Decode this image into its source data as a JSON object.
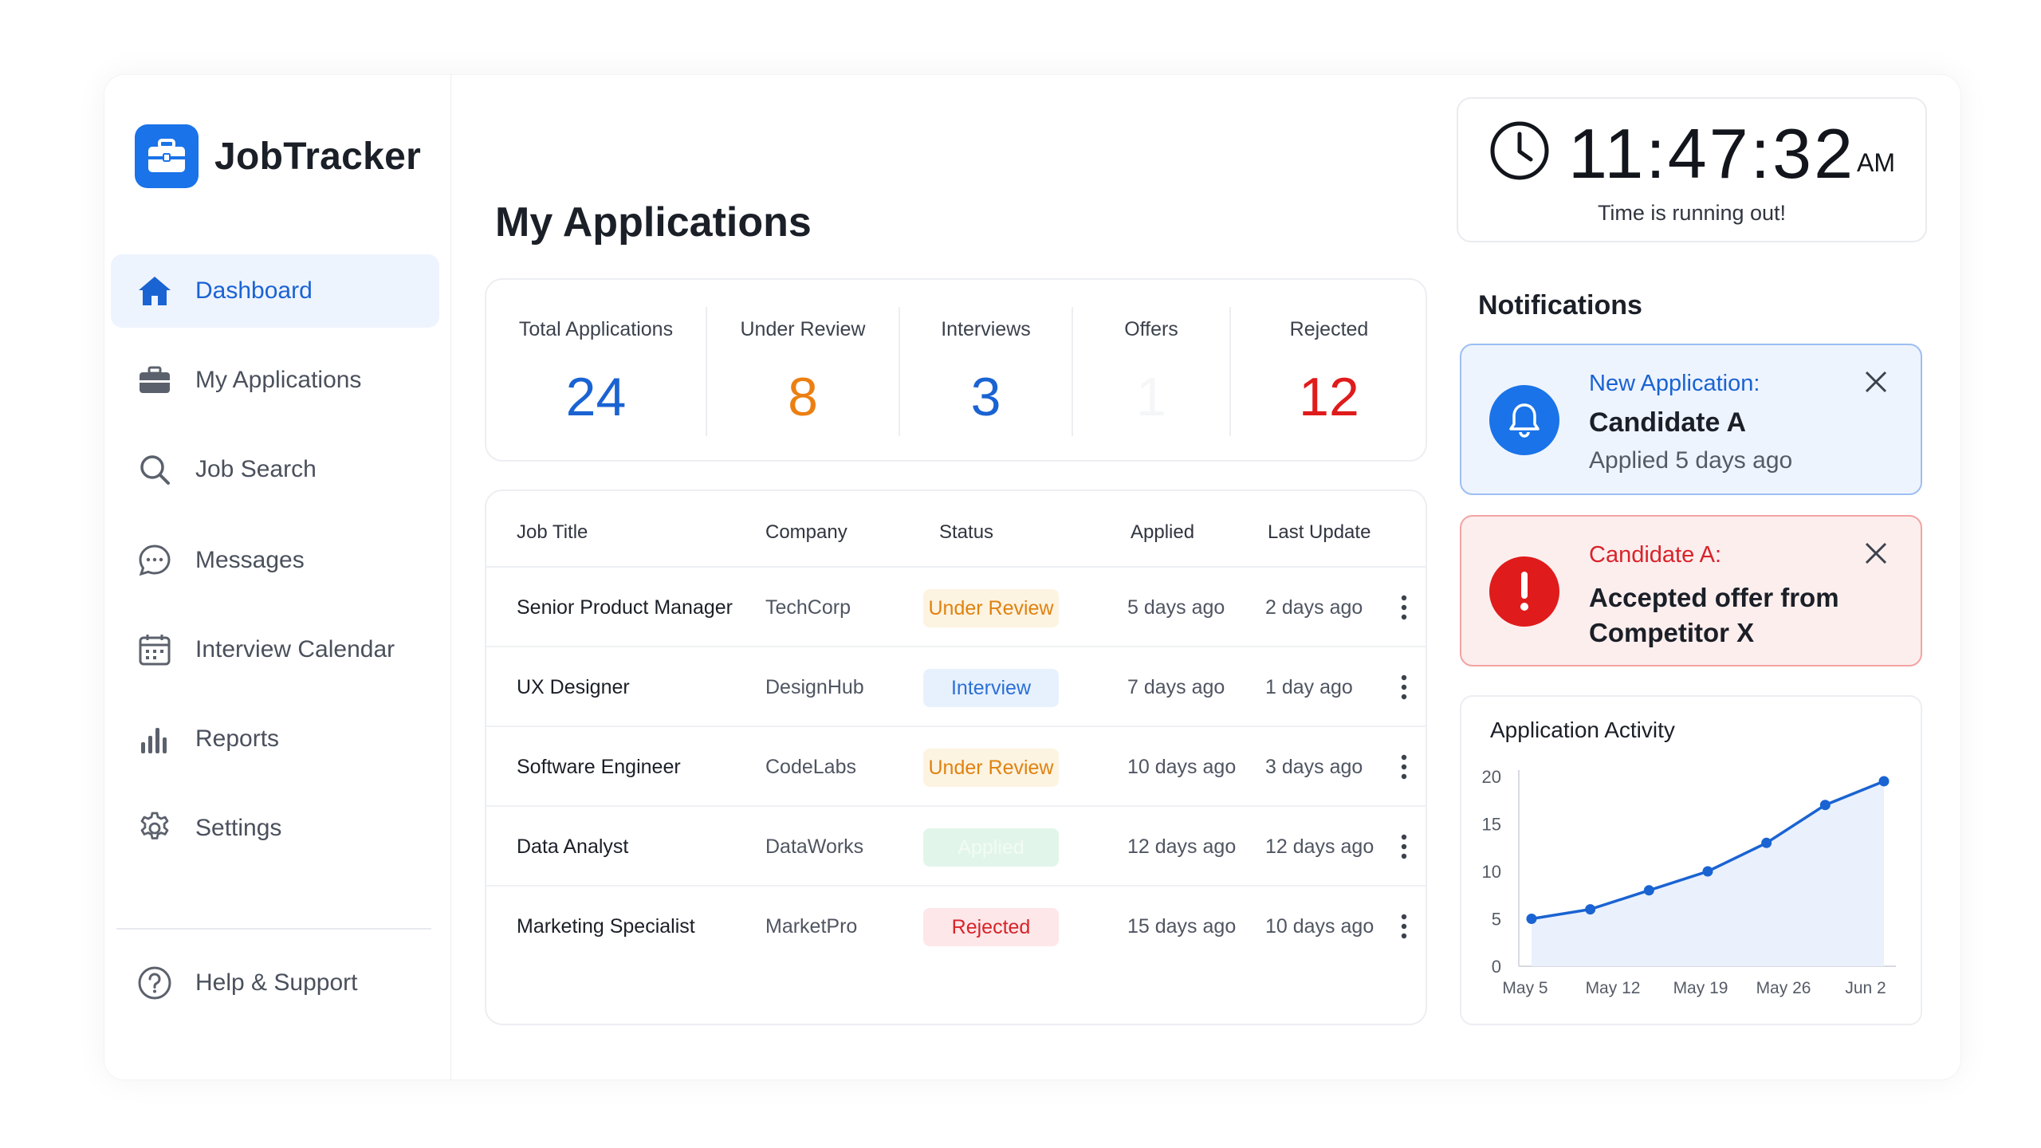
{
  "app": {
    "name": "JobTracker"
  },
  "sidebar": {
    "items": [
      {
        "label": "Dashboard",
        "icon": "home-icon",
        "active": true
      },
      {
        "label": "My Applications",
        "icon": "briefcase-icon",
        "active": false
      },
      {
        "label": "Job Search",
        "icon": "search-icon",
        "active": false
      },
      {
        "label": "Messages",
        "icon": "chat-icon",
        "active": false
      },
      {
        "label": "Interview Calendar",
        "icon": "calendar-icon",
        "active": false
      },
      {
        "label": "Reports",
        "icon": "bar-chart-icon",
        "active": false
      },
      {
        "label": "Settings",
        "icon": "gear-icon",
        "active": false
      }
    ],
    "help": {
      "label": "Help & Support",
      "icon": "help-icon"
    }
  },
  "main": {
    "title": "My Applications",
    "stats": [
      {
        "label": "Total Applications",
        "value": "24",
        "color": "#1a63d2"
      },
      {
        "label": "Under Review",
        "value": "8",
        "color": "#ec7f12"
      },
      {
        "label": "Interviews",
        "value": "3",
        "color": "#1a63d2"
      },
      {
        "label": "Offers",
        "value": "1",
        "color": "#f5f6f8"
      },
      {
        "label": "Rejected",
        "value": "12",
        "color": "#e01b1b"
      }
    ],
    "table": {
      "columns": [
        "Job Title",
        "Company",
        "Status",
        "Applied",
        "Last Update"
      ],
      "rows": [
        {
          "title": "Senior Product Manager",
          "company": "TechCorp",
          "status": "Under Review",
          "status_type": "review",
          "applied": "5 days ago",
          "updated": "2 days ago"
        },
        {
          "title": "UX Designer",
          "company": "DesignHub",
          "status": "Interview",
          "status_type": "interview",
          "applied": "7 days ago",
          "updated": "1 day ago"
        },
        {
          "title": "Software Engineer",
          "company": "CodeLabs",
          "status": "Under Review",
          "status_type": "review",
          "applied": "10 days ago",
          "updated": "3 days ago"
        },
        {
          "title": "Data Analyst",
          "company": "DataWorks",
          "status": "Applied",
          "status_type": "applied",
          "applied": "12 days ago",
          "updated": "12 days ago"
        },
        {
          "title": "Marketing Specialist",
          "company": "MarketPro",
          "status": "Rejected",
          "status_type": "rejected",
          "applied": "15 days ago",
          "updated": "10 days ago"
        }
      ]
    }
  },
  "timer": {
    "time": "11:47:32",
    "ampm": "AM",
    "message": "Time is running out!"
  },
  "notifications": {
    "title": "Notifications",
    "items": [
      {
        "type": "info",
        "heading": "New Application:",
        "main": "Candidate A",
        "sub": "Applied 5 days ago",
        "icon": "bell-icon"
      },
      {
        "type": "alert",
        "heading": "Candidate A:",
        "main": "Accepted offer from Competitor X",
        "sub": "",
        "icon": "exclamation-icon"
      }
    ]
  },
  "activity": {
    "title": "Application Activity",
    "chart_data": {
      "type": "area",
      "title": "Application Activity",
      "x": [
        "May 5",
        "",
        "May 12",
        "",
        "May 19",
        "",
        "May 26",
        "",
        "Jun 2"
      ],
      "x_tick_labels": [
        "May 5",
        "May 12",
        "May 19",
        "May 26",
        "Jun 2"
      ],
      "values": [
        5,
        6,
        8,
        10,
        13,
        17,
        19.5
      ],
      "ylim": [
        0,
        20
      ],
      "y_ticks": [
        0,
        5,
        10,
        15,
        20
      ],
      "color": "#1a63d2",
      "fill": "#eaf1fd",
      "grid": false
    }
  }
}
